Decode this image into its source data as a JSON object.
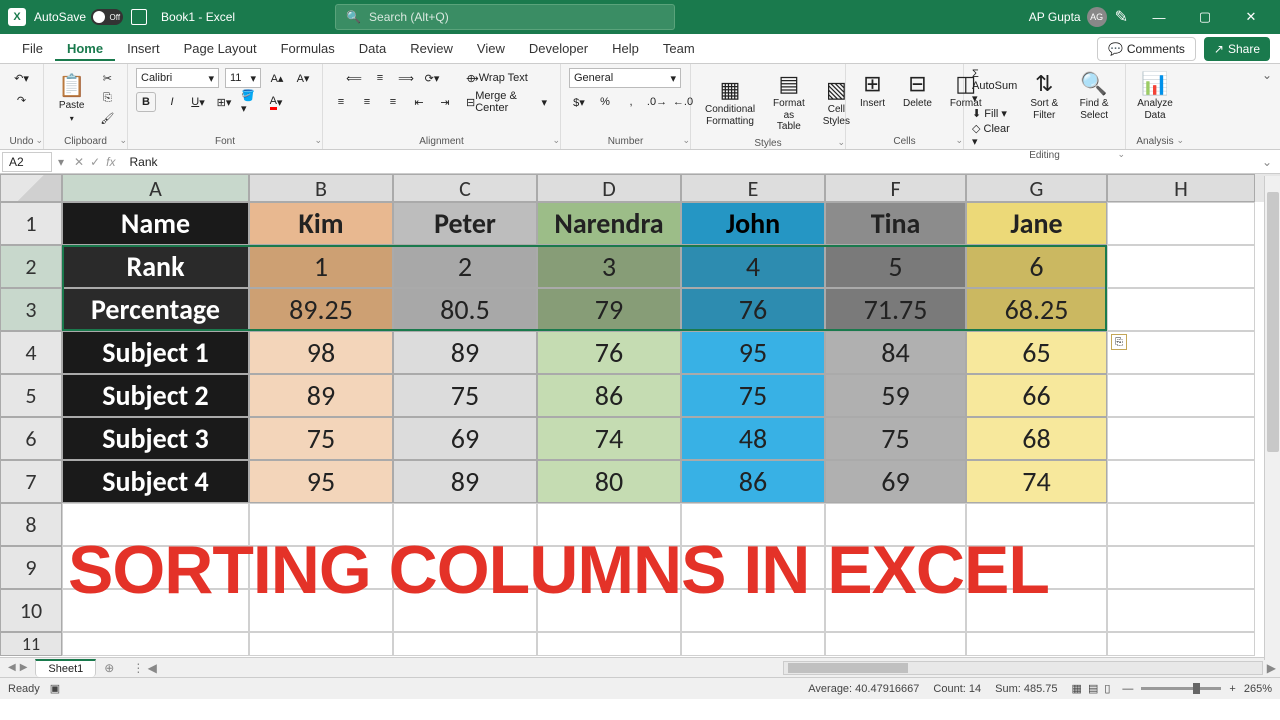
{
  "titlebar": {
    "autosave": "AutoSave",
    "autosave_state": "Off",
    "doc_name": "Book1 - Excel",
    "search_placeholder": "Search (Alt+Q)",
    "user_name": "AP Gupta",
    "user_initials": "AG"
  },
  "tabs": {
    "file": "File",
    "home": "Home",
    "insert": "Insert",
    "page_layout": "Page Layout",
    "formulas": "Formulas",
    "data": "Data",
    "review": "Review",
    "view": "View",
    "developer": "Developer",
    "help": "Help",
    "team": "Team",
    "comments": "Comments",
    "share": "Share"
  },
  "ribbon": {
    "undo_label": "Undo",
    "paste": "Paste",
    "clipboard_label": "Clipboard",
    "font_name": "Calibri",
    "font_size": "11",
    "font_label": "Font",
    "wrap_text": "Wrap Text",
    "merge_center": "Merge & Center",
    "alignment_label": "Alignment",
    "number_format": "General",
    "number_label": "Number",
    "cond_format": "Conditional Formatting",
    "format_table": "Format as Table",
    "cell_styles": "Cell Styles",
    "styles_label": "Styles",
    "insert": "Insert",
    "delete": "Delete",
    "format": "Format",
    "cells_label": "Cells",
    "autosum": "AutoSum",
    "fill": "Fill",
    "clear": "Clear",
    "editing_label": "Editing",
    "sort_filter": "Sort & Filter",
    "find_select": "Find & Select",
    "analyze": "Analyze Data",
    "analysis_label": "Analysis"
  },
  "fbar": {
    "cell_ref": "A2",
    "formula": "Rank"
  },
  "columns": [
    "A",
    "B",
    "C",
    "D",
    "E",
    "F",
    "G",
    "H"
  ],
  "rows": [
    "1",
    "2",
    "3",
    "4",
    "5",
    "6",
    "7",
    "8",
    "9",
    "10",
    "11"
  ],
  "grid": {
    "headers": [
      "Name",
      "Kim",
      "Peter",
      "Narendra",
      "John",
      "Tina",
      "Jane"
    ],
    "row_labels": [
      "Rank",
      "Percentage",
      "Subject 1",
      "Subject 2",
      "Subject 3",
      "Subject 4"
    ],
    "data": [
      [
        "1",
        "2",
        "3",
        "4",
        "5",
        "6"
      ],
      [
        "89.25",
        "80.5",
        "79",
        "76",
        "71.75",
        "68.25"
      ],
      [
        "98",
        "89",
        "76",
        "95",
        "84",
        "65"
      ],
      [
        "89",
        "75",
        "86",
        "75",
        "59",
        "66"
      ],
      [
        "75",
        "69",
        "74",
        "48",
        "75",
        "68"
      ],
      [
        "95",
        "89",
        "80",
        "86",
        "69",
        "74"
      ]
    ]
  },
  "overlay": "SORTING COLUMNS IN EXCEL",
  "sheet_tabs": {
    "sheet1": "Sheet1"
  },
  "status": {
    "ready": "Ready",
    "average_label": "Average:",
    "average": "40.47916667",
    "count_label": "Count:",
    "count": "14",
    "sum_label": "Sum:",
    "sum": "485.75",
    "zoom": "265%"
  }
}
